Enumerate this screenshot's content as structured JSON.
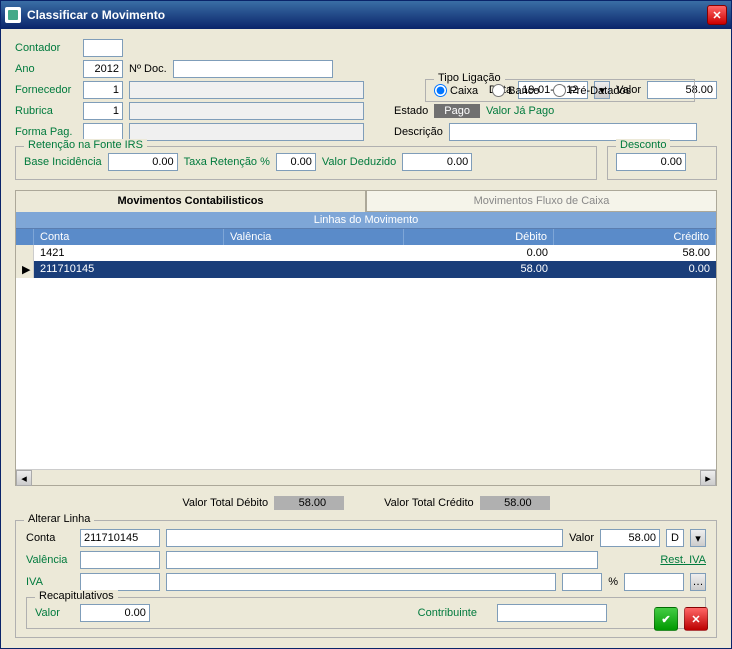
{
  "window": {
    "title": "Classificar o Movimento"
  },
  "form": {
    "contador_label": "Contador",
    "contador": "",
    "ano_label": "Ano",
    "ano": "2012",
    "ndoc_label": "Nº Doc.",
    "ndoc": "",
    "fornecedor_label": "Fornecedor",
    "fornecedor_code": "1",
    "fornecedor_name": "",
    "rubrica_label": "Rubrica",
    "rubrica_code": "1",
    "rubrica_name": "",
    "formapag_label": "Forma Pag.",
    "formapag_code": "",
    "formapag_name": "",
    "data_label": "Data",
    "data": "19-01-2012",
    "valor_label": "Valor",
    "valor": "58.00",
    "estado_label": "Estado",
    "estado_value": "Pago",
    "valor_ja_pago_label": "Valor Já Pago",
    "descricao_label": "Descrição",
    "descricao": ""
  },
  "tipo_ligacao": {
    "legend": "Tipo Ligação",
    "options": {
      "caixa": "Caixa",
      "banco": "Banco",
      "predatados": "Pré-Datados"
    },
    "selected": "caixa"
  },
  "retencao": {
    "legend": "Retenção na Fonte IRS",
    "base_label": "Base Incidência",
    "base": "0.00",
    "taxa_label": "Taxa Retenção %",
    "taxa": "0.00",
    "deduzido_label": "Valor Deduzido",
    "deduzido": "0.00"
  },
  "desconto": {
    "legend": "Desconto",
    "value": "0.00"
  },
  "tabs": {
    "active": "Movimentos Contabilisticos",
    "inactive": "Movimentos Fluxo de Caixa"
  },
  "grid": {
    "title": "Linhas do Movimento",
    "headers": {
      "conta": "Conta",
      "valencia": "Valência",
      "debito": "Débito",
      "credito": "Crédito"
    },
    "rows": [
      {
        "marker": "",
        "conta": "1421",
        "valencia": "",
        "debito": "0.00",
        "credito": "58.00"
      },
      {
        "marker": "▶",
        "conta": "211710145",
        "valencia": "",
        "debito": "58.00",
        "credito": "0.00"
      }
    ]
  },
  "totals": {
    "debito_label": "Valor Total Débito",
    "debito": "58.00",
    "credito_label": "Valor Total Crédito",
    "credito": "58.00"
  },
  "alterar": {
    "legend": "Alterar Linha",
    "conta_label": "Conta",
    "conta": "211710145",
    "conta_desc": "",
    "valor_label": "Valor",
    "valor": "58.00",
    "dc": "D",
    "valencia_label": "Valência",
    "valencia_code": "",
    "valencia_desc": "",
    "rest_iva_label": "Rest. IVA",
    "iva_label": "IVA",
    "iva_code": "",
    "iva_desc": "",
    "iva_pct": "",
    "pct_symbol": "%",
    "recap_legend": "Recapitulativos",
    "recap_valor_label": "Valor",
    "recap_valor": "0.00",
    "contribuinte_label": "Contribuinte",
    "contribuinte": ""
  }
}
